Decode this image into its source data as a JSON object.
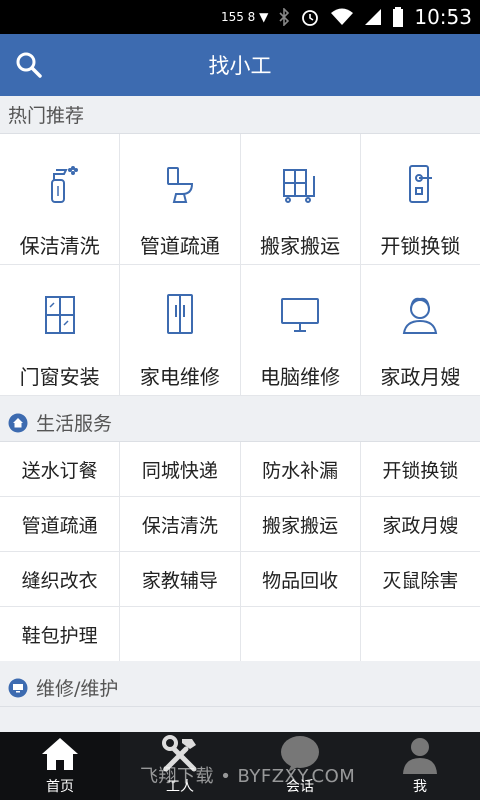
{
  "status_bar": {
    "network": "155 8 ▼",
    "time": "10:53"
  },
  "app_bar": {
    "title": "找小工",
    "search_icon": "search-icon"
  },
  "hot": {
    "title": "热门推荐",
    "items": [
      {
        "label": "保洁清洗",
        "icon": "spray-bottle-icon"
      },
      {
        "label": "管道疏通",
        "icon": "toilet-icon"
      },
      {
        "label": "搬家搬运",
        "icon": "moving-cart-icon"
      },
      {
        "label": "开锁换锁",
        "icon": "door-lock-icon"
      },
      {
        "label": "门窗安装",
        "icon": "window-icon"
      },
      {
        "label": "家电维修",
        "icon": "refrigerator-icon"
      },
      {
        "label": "电脑维修",
        "icon": "monitor-icon"
      },
      {
        "label": "家政月嫂",
        "icon": "housekeeper-icon"
      }
    ]
  },
  "life": {
    "title": "生活服务",
    "icon": "home-icon",
    "items": [
      "送水订餐",
      "同城快递",
      "防水补漏",
      "开锁换锁",
      "管道疏通",
      "保洁清洗",
      "搬家搬运",
      "家政月嫂",
      "缝织改衣",
      "家教辅导",
      "物品回收",
      "灭鼠除害",
      "鞋包护理"
    ]
  },
  "repair": {
    "title": "维修/维护",
    "icon": "monitor-small-icon"
  },
  "tabs": [
    {
      "label": "首页",
      "icon": "home-tab-icon",
      "active": true
    },
    {
      "label": "工人",
      "icon": "tools-icon",
      "active": false
    },
    {
      "label": "会话",
      "icon": "chat-bubble-icon",
      "active": false
    },
    {
      "label": "我",
      "icon": "user-icon",
      "active": false
    }
  ],
  "watermark": "飞翔下载 • BYFZXY.COM",
  "colors": {
    "accent": "#3d6bb0",
    "tabbar": "#191b1e",
    "icon_blue": "#3d6bb0"
  }
}
